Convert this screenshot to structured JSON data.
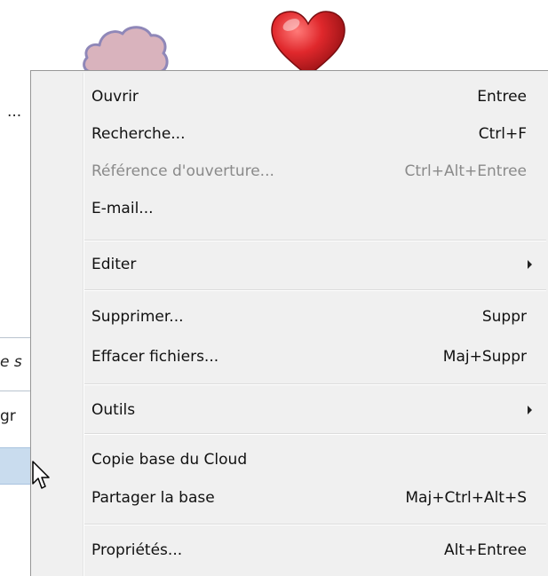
{
  "background": {
    "ellipsis": "...",
    "fragment_italic": "e s",
    "fragment_plain": "gr"
  },
  "icons": {
    "cloud": "cloud-icon",
    "heart": "heart-icon",
    "cursor": "mouse-pointer-icon"
  },
  "colors": {
    "menu_background": "#f0f0f0",
    "disabled_text": "#8a8a8a",
    "heart_red": "#d8262b",
    "cloud_fill": "#d9b3bd",
    "cloud_outline": "#8f87b8",
    "selected_row": "#c9dcee"
  },
  "menu": {
    "items": [
      {
        "label": "Ouvrir",
        "shortcut": "Entree",
        "enabled": true
      },
      {
        "label": "Recherche...",
        "shortcut": "Ctrl+F",
        "enabled": true
      },
      {
        "label": "Référence d'ouverture...",
        "shortcut": "Ctrl+Alt+Entree",
        "enabled": false
      },
      {
        "label": "E-mail...",
        "shortcut": "",
        "enabled": true
      },
      {
        "label": "Editer",
        "shortcut": "",
        "enabled": true,
        "submenu": true
      },
      {
        "label": "Supprimer...",
        "shortcut": "Suppr",
        "enabled": true
      },
      {
        "label": "Effacer fichiers...",
        "shortcut": "Maj+Suppr",
        "enabled": true
      },
      {
        "label": "Outils",
        "shortcut": "",
        "enabled": true,
        "submenu": true
      },
      {
        "label": "Copie base du Cloud",
        "shortcut": "",
        "enabled": true
      },
      {
        "label": "Partager la base",
        "shortcut": "Maj+Ctrl+Alt+S",
        "enabled": true
      },
      {
        "label": "Propriétés...",
        "shortcut": "Alt+Entree",
        "enabled": true
      }
    ]
  }
}
